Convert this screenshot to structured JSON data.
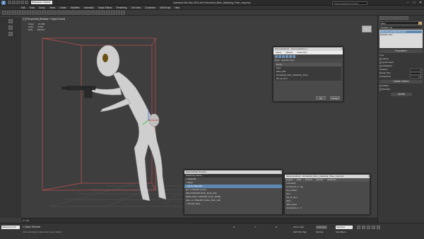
{
  "titlebar": {
    "app_logo": "3",
    "workspace": "Workspace: Default",
    "title": "Autodesk 3ds Max 2014 x64    Humanoid_Alien_Attacking_Pose_vray.max",
    "search_placeholder": "Type a keyword or phrase",
    "icons": [
      "minimize-icon",
      "maximize-icon",
      "close-icon"
    ]
  },
  "menu": {
    "items": [
      "Edit",
      "Tools",
      "Group",
      "Views",
      "Create",
      "Modifiers",
      "Animation",
      "Graph Editors",
      "Rendering",
      "Civil View",
      "Customize",
      "MAXScript",
      "Help"
    ]
  },
  "viewport": {
    "label": "[+] [Perspective] [Realistic + Edged Faces]",
    "stats": {
      "total_label": "Total",
      "polys_label": "Polys:",
      "polys_value": "11 308",
      "verts_label": "Verts:",
      "verts_value": "8 834",
      "fps_label": "FPS:",
      "fps_value": "206.637"
    }
  },
  "command_panel": {
    "object_name": "Alien",
    "modifier_list": "Modifier List",
    "stack": [
      "TurboSmooth/MeshSmooth",
      "Editable Poly"
    ],
    "stack_selected": 0,
    "section": "Parameters",
    "rows": [
      {
        "label": "Type",
        "value": ""
      },
      {
        "label": "Classic",
        "value": ""
      },
      {
        "label": "Quad Output",
        "value": ""
      },
      {
        "label": "Subdivision",
        "value": ""
      },
      {
        "label": "Iterations:",
        "value": "1"
      },
      {
        "label": "Render Iters:",
        "value": "2"
      },
      {
        "label": "Smoothness:",
        "value": "1,0"
      },
      {
        "label": "Update Options",
        "value": ""
      },
      {
        "label": "Always",
        "value": ""
      },
      {
        "label": "Manually",
        "value": ""
      },
      {
        "label": "Update",
        "value": ""
      }
    ]
  },
  "scene_explorer": {
    "title": "Scene Explorer - Scene Explorer 1",
    "menu": [
      "Select",
      "Display",
      "Customize"
    ],
    "find_label": "Find:",
    "selection_set": "Selection Set:",
    "column": "Name",
    "items": [
      "Alien",
      "Alien_001",
      "Humanoid_Alien_Attacking_Pose",
      "Sci_Fi_Gun"
    ],
    "ok": "OK",
    "cancel": "Cancel"
  },
  "material_browser": {
    "title": "Material/Map Browser",
    "search": "Search by Name ...",
    "groups": [
      "+ Materials",
      "+ Maps",
      "- Scene Materials"
    ],
    "items": [
      "gun ( VRayMtl ) [Gun]",
      "Map #1619245 [Alien_Body_dsf]",
      "Metal_Parts ( VRayMtl ) [Gun_Metal]",
      "alien_a ( VRayMtl ) [Alien_Alien_dsf]"
    ],
    "footer": "+ Sample Slots"
  },
  "layer_explorer": {
    "title": "Scene Explorer - Humanoid_Alien_Attacking_Pose_vray.max",
    "columns": [
      "Layers",
      "Hide",
      "Freeze",
      "Render",
      "Radiosity"
    ],
    "items": [
      "0 (default)",
      "Humanoid_A...ing",
      "Gun_Metal",
      "Gun",
      "Sci_Fi_Gun",
      "Alien",
      "Alien_Eyes",
      "Humanoid_A...d"
    ]
  },
  "timeline": {
    "range": "0 / 100"
  },
  "status": {
    "maxscript": "Welcome to M",
    "message": "1 Object Selected",
    "prompt": "Click and drag to select and move objects",
    "x_label": "X:",
    "y_label": "Y:",
    "z_label": "Z:",
    "grid": "Grid = 10,0",
    "autokey": "Auto Key",
    "selected": "Selected",
    "add_time_tag": "Add Time Tag",
    "set_key": "Set Key",
    "key_filters": "Key Filters..."
  }
}
